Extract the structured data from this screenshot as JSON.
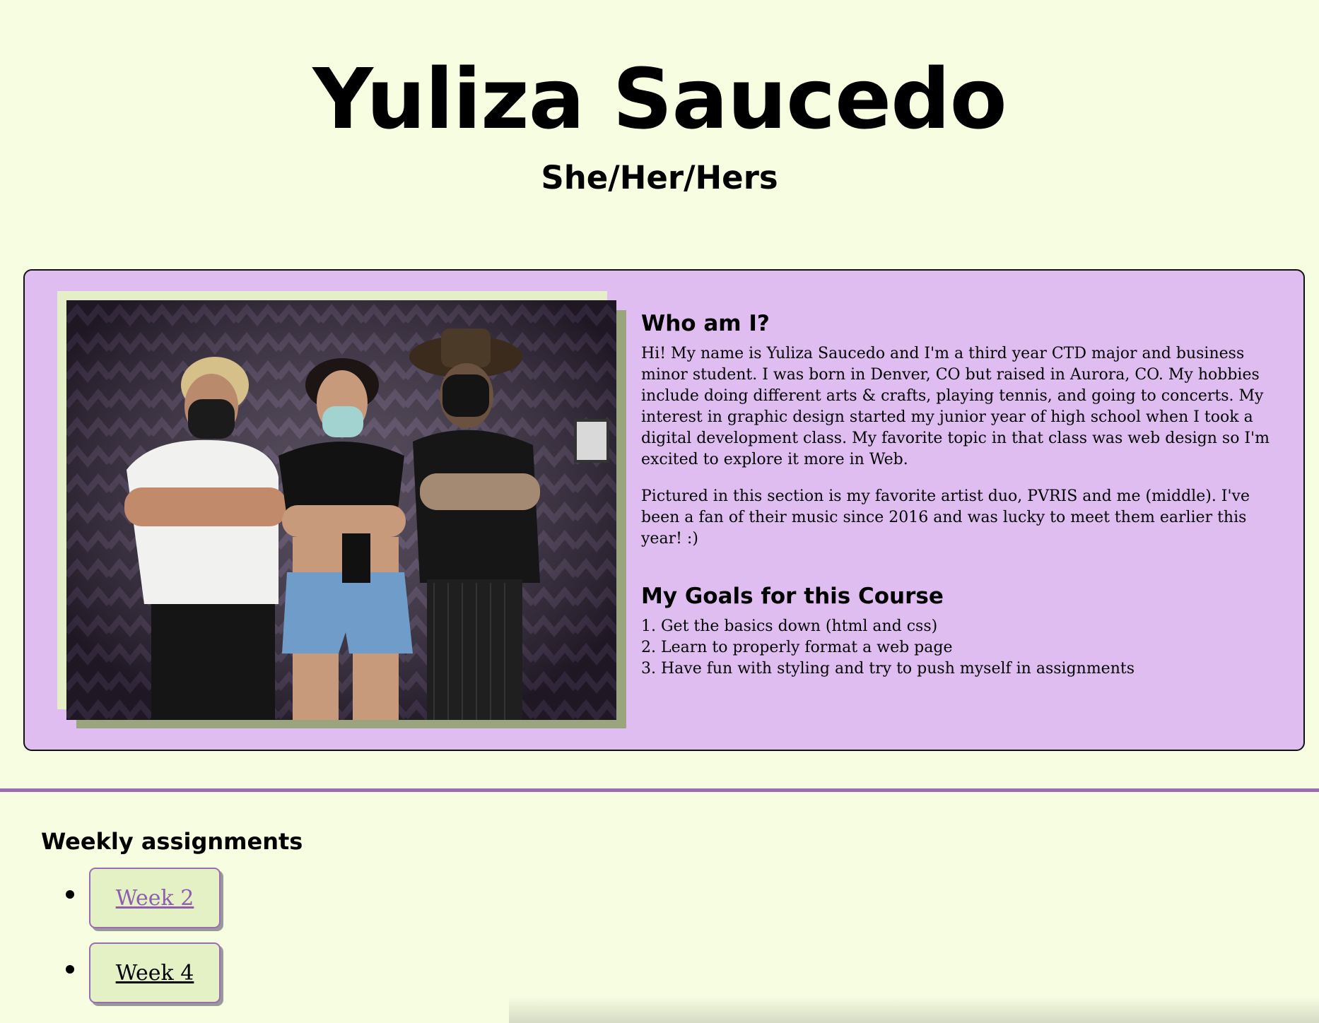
{
  "header": {
    "name": "Yuliza Saucedo",
    "pronouns": "She/Her/Hers"
  },
  "about": {
    "photo_icon": "photo-of-pvris-duo-and-yuliza",
    "who_heading": "Who am I?",
    "paragraph_1": "Hi! My name is Yuliza Saucedo and I'm a third year CTD major and business minor student. I was born in Denver, CO but raised in Aurora, CO. My hobbies include doing different arts & crafts, playing tennis, and going to concerts. My interest in graphic design started my junior year of high school when I took a digital development class. My favorite topic in that class was web design so I'm excited to explore it more in Web.",
    "paragraph_2": "Pictured in this section is my favorite artist duo, PVRIS and me (middle). I've been a fan of their music since 2016 and was lucky to meet them earlier this year! :)",
    "goals_heading": "My Goals for this Course",
    "goals": [
      "1. Get the basics down (html and css)",
      "2. Learn to properly format a web page",
      "3. Have fun with styling and try to push myself in assignments"
    ]
  },
  "assignments": {
    "heading": "Weekly assignments",
    "items": [
      {
        "label": "Week 2",
        "visited": true
      },
      {
        "label": "Week 4",
        "visited": false
      }
    ]
  },
  "colors": {
    "page_background": "#f7fde0",
    "card_background": "#dfbdf0",
    "accent_purple": "#9b6cb5",
    "button_background": "#e4f1c4",
    "photo_frame_light": "#e5efc7",
    "photo_frame_dark": "#9aa57e"
  }
}
